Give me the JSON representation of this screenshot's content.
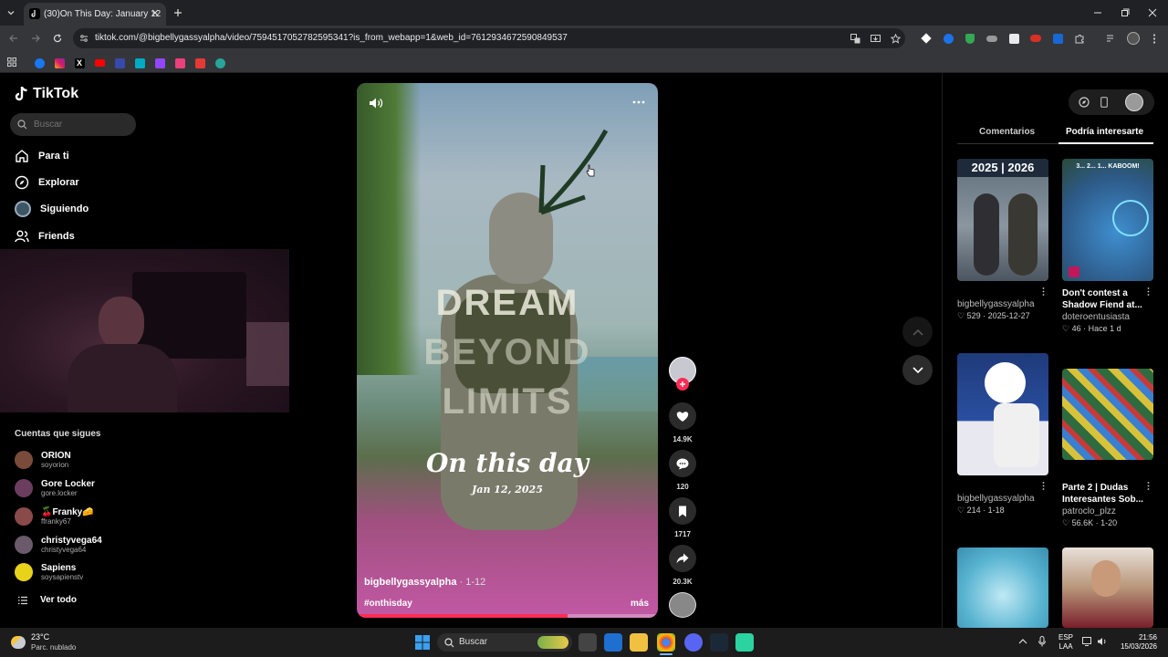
{
  "browser": {
    "tab_title": "(30)On This Day: January 12",
    "url": "tiktok.com/@bigbellygassyalpha/video/7594517052782595341?is_from_webapp=1&web_id=7612934672590849537",
    "bookmark_icons": [
      "apps-icon",
      "facebook-icon",
      "instagram-icon",
      "x-icon",
      "youtube-icon",
      "bookmark-icon",
      "bookmark-icon",
      "twitch-icon",
      "bookmark-icon",
      "bookmark-icon",
      "bookmark-icon"
    ]
  },
  "sidebar": {
    "logo": "TikTok",
    "search_placeholder": "Buscar",
    "nav": [
      {
        "label": "Para ti",
        "icon": "home-icon"
      },
      {
        "label": "Explorar",
        "icon": "compass-icon"
      },
      {
        "label": "Siguiendo",
        "icon": "following-icon"
      },
      {
        "label": "Friends",
        "icon": "friends-icon"
      }
    ],
    "following_title": "Cuentas que sigues",
    "accounts": [
      {
        "name": "ORION",
        "handle": "soyorion",
        "color": "#7a4b3a"
      },
      {
        "name": "Gore Locker",
        "handle": "gore.locker",
        "color": "#6b3d5e"
      },
      {
        "name": "🍒Franky🧀",
        "handle": "ffranky67",
        "color": "#8b4a4a"
      },
      {
        "name": "christyvega64",
        "handle": "christyvega64",
        "color": "#6a5a6a"
      },
      {
        "name": "Sapiens",
        "handle": "soysapienstv",
        "color": "#e8d21a"
      }
    ],
    "see_all": "Ver todo"
  },
  "video": {
    "headline": "DREAM",
    "headline2": "BEYOND",
    "headline3": "LIMITS",
    "title": "On this day",
    "date": "Jan 12, 2025",
    "author": "bigbellygassyalpha",
    "post_date": "· 1-12",
    "hashtag": "#onthisday",
    "more": "más",
    "progress": 0.7
  },
  "actions": {
    "likes": "14.9K",
    "comments": "120",
    "saves": "1717",
    "shares": "20.3K"
  },
  "right_panel": {
    "tabs": [
      "Comentarios",
      "Podría interesarte"
    ],
    "cards": [
      {
        "badge": "2025 | 2026",
        "title": "",
        "author": "bigbellygassyalpha",
        "stats": "♡ 529 · 2025-12-27",
        "color": "#6a7e8c"
      },
      {
        "badge": "3... 2... 1... KABOOM!",
        "title": "Don't contest a Shadow Fiend at...",
        "author": "doteroentusiasta",
        "stats": "♡ 46 · Hace 1 d",
        "color": "#3f6f9c"
      },
      {
        "badge": "",
        "title": "",
        "author": "bigbellygassyalpha",
        "stats": "♡ 214 · 1-18",
        "color": "#1f3a7a"
      },
      {
        "badge": "",
        "title": "Parte 2 | Dudas Interesantes Sob...",
        "author": "patroclo_plzz",
        "stats": "♡ 56.6K · 1-20",
        "color": "#2e6b3f"
      },
      {
        "badge": "",
        "title": "",
        "author": "",
        "stats": "",
        "color": "#57b3d0"
      },
      {
        "badge": "",
        "title": "",
        "author": "",
        "stats": "",
        "color": "#b8967a"
      }
    ]
  },
  "taskbar": {
    "weather_temp": "23°C",
    "weather_desc": "Parc. nublado",
    "search": "Buscar",
    "lang1": "ESP",
    "lang2": "LAA",
    "time": "21:56",
    "date": "15/03/2026"
  }
}
